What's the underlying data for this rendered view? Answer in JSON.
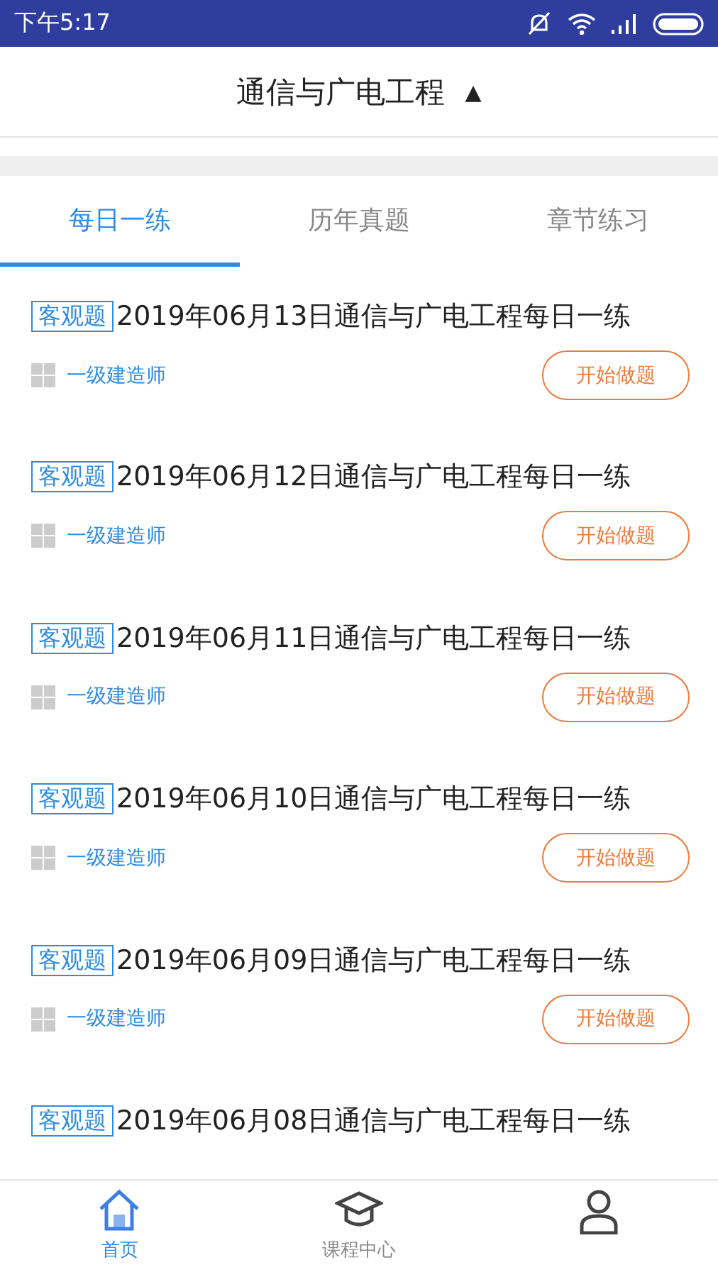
{
  "status_bar": {
    "time": "下午5:17"
  },
  "header": {
    "title": "通信与广电工程",
    "caret": "▲"
  },
  "tabs": [
    {
      "label": "每日一练",
      "selected": true
    },
    {
      "label": "历年真题",
      "selected": false
    },
    {
      "label": "章节练习",
      "selected": false
    }
  ],
  "items": [
    {
      "tag": "客观题",
      "title": "2019年06月13日通信与广电工程每日一练",
      "category": "一级建造师",
      "button": "开始做题"
    },
    {
      "tag": "客观题",
      "title": "2019年06月12日通信与广电工程每日一练",
      "category": "一级建造师",
      "button": "开始做题"
    },
    {
      "tag": "客观题",
      "title": "2019年06月11日通信与广电工程每日一练",
      "category": "一级建造师",
      "button": "开始做题"
    },
    {
      "tag": "客观题",
      "title": "2019年06月10日通信与广电工程每日一练",
      "category": "一级建造师",
      "button": "开始做题"
    },
    {
      "tag": "客观题",
      "title": "2019年06月09日通信与广电工程每日一练",
      "category": "一级建造师",
      "button": "开始做题"
    },
    {
      "tag": "客观题",
      "title": "2019年06月08日通信与广电工程每日一练"
    }
  ],
  "nav": [
    {
      "kind": "home",
      "label": "首页",
      "selected": true
    },
    {
      "kind": "course",
      "label": "课程中心",
      "selected": false
    },
    {
      "kind": "profile",
      "selected": false
    }
  ]
}
